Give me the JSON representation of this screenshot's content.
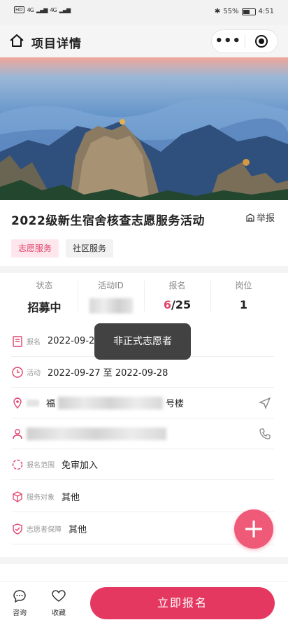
{
  "status_bar": {
    "left_chips": [
      "HD",
      "HD"
    ],
    "signal": [
      "4G",
      "4G"
    ],
    "battery_percent": "55%",
    "time": "4:51",
    "battery_level": 0.55
  },
  "nav": {
    "title": "项目详情",
    "more_icon": "ellipsis-icon",
    "close_icon": "target-icon"
  },
  "project": {
    "title": "2022级新生宿舍核查志愿服务活动",
    "report_label": "举报",
    "tags": [
      "志愿服务",
      "社区服务"
    ]
  },
  "stats": {
    "status_label": "状态",
    "status_value": "招募中",
    "activity_id_label": "活动ID",
    "signup_label": "报名",
    "signup_current": "6",
    "signup_total": "/25",
    "positions_label": "岗位",
    "positions_value": "1"
  },
  "rows": {
    "signup_label": "报名",
    "signup_value": "2022-09-2",
    "activity_label": "活动",
    "activity_value": "2022-09-27 至 2022-09-28",
    "location_value_prefix": "福",
    "location_value_suffix": "号楼",
    "scope_label": "报名范围",
    "scope_value": "免审加入",
    "target_label": "服务对象",
    "target_value": "其他",
    "guarantee_label": "志愿者保障",
    "guarantee_value": "其他"
  },
  "toast": {
    "text": "非正式志愿者"
  },
  "bottom": {
    "consult_label": "咨询",
    "favorite_label": "收藏",
    "signup_button": "立即报名"
  },
  "colors": {
    "accent": "#e53861",
    "fab": "#f05a79",
    "tag_pink_bg": "#fde7ec",
    "tag_pink_text": "#e0436c"
  }
}
